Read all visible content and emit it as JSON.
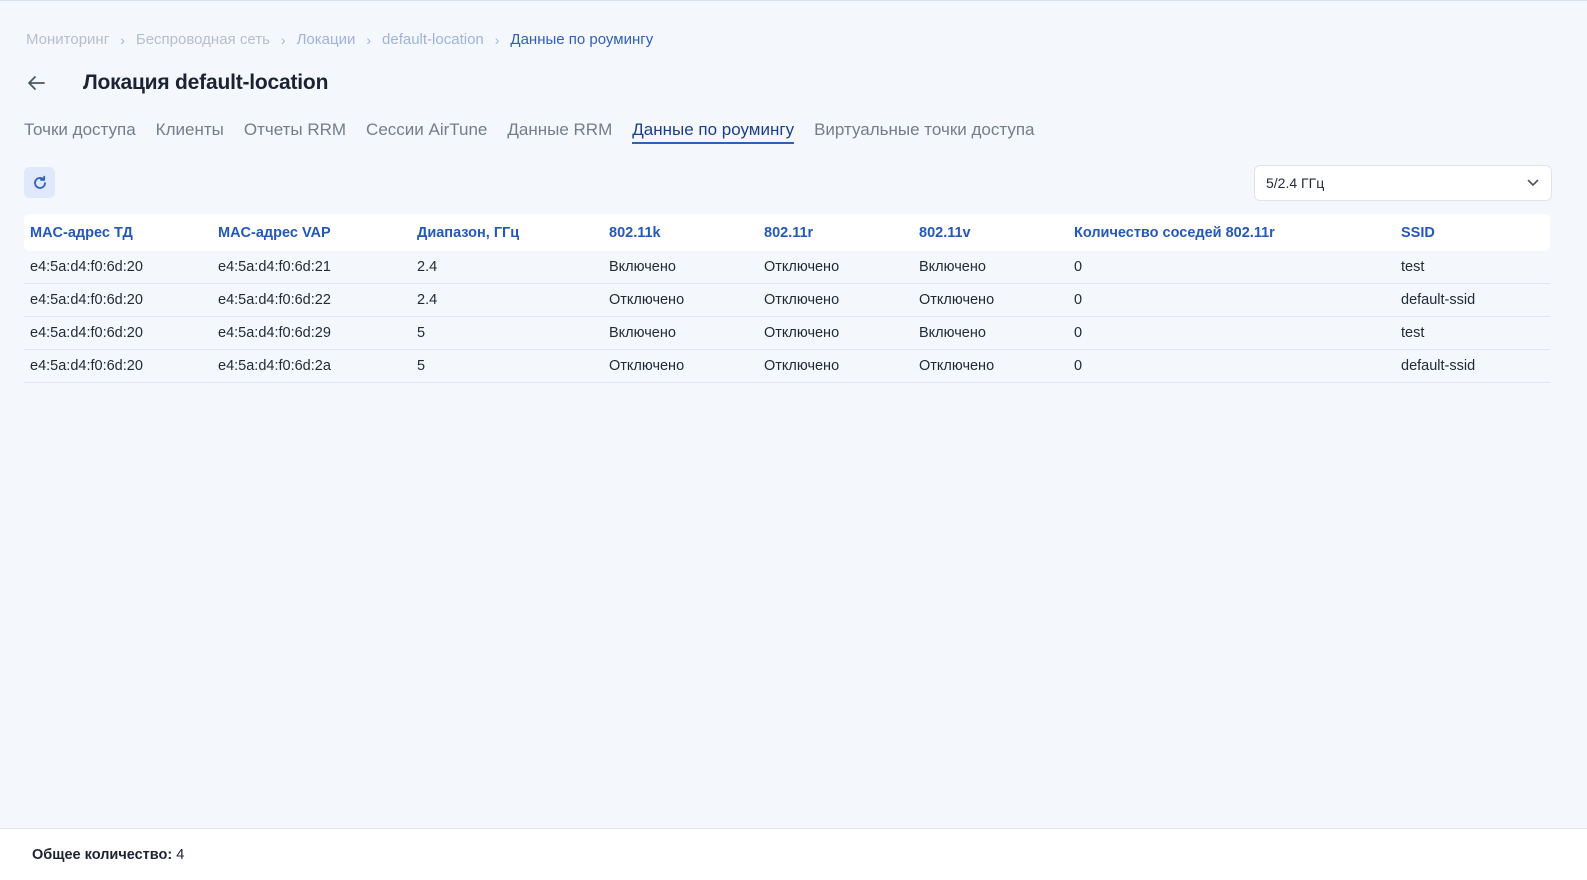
{
  "breadcrumb": {
    "items": [
      "Мониторинг",
      "Беспроводная сеть",
      "Локации",
      "default-location",
      "Данные по роумингу"
    ]
  },
  "header": {
    "title": "Локация default-location"
  },
  "tabs": [
    {
      "label": "Точки доступа"
    },
    {
      "label": "Клиенты"
    },
    {
      "label": "Отчеты RRM"
    },
    {
      "label": "Сессии AirTune"
    },
    {
      "label": "Данные RRM"
    },
    {
      "label": "Данные по роумингу",
      "active": true
    },
    {
      "label": "Виртуальные точки доступа"
    }
  ],
  "toolbar": {
    "band_select_value": "5/2.4 ГГц"
  },
  "table": {
    "columns": [
      "MAC-адрес ТД",
      "MAC-адрес VAP",
      "Диапазон, ГГц",
      "802.11k",
      "802.11r",
      "802.11v",
      "Количество соседей 802.11r",
      "SSID"
    ],
    "rows": [
      [
        "e4:5a:d4:f0:6d:20",
        "e4:5a:d4:f0:6d:21",
        "2.4",
        "Включено",
        "Отключено",
        "Включено",
        "0",
        "test"
      ],
      [
        "e4:5a:d4:f0:6d:20",
        "e4:5a:d4:f0:6d:22",
        "2.4",
        "Отключено",
        "Отключено",
        "Отключено",
        "0",
        "default-ssid"
      ],
      [
        "e4:5a:d4:f0:6d:20",
        "e4:5a:d4:f0:6d:29",
        "5",
        "Включено",
        "Отключено",
        "Включено",
        "0",
        "test"
      ],
      [
        "e4:5a:d4:f0:6d:20",
        "e4:5a:d4:f0:6d:2a",
        "5",
        "Отключено",
        "Отключено",
        "Отключено",
        "0",
        "default-ssid"
      ]
    ]
  },
  "footer": {
    "total_label": "Общее количество:",
    "total_value": "4"
  },
  "colors": {
    "accent": "#2f5fbd",
    "header_text": "#2458b8",
    "background": "#f4f7fc"
  },
  "icons": {
    "back": "arrow-left-icon",
    "refresh": "refresh-icon",
    "dropdown": "chevron-down-icon",
    "breadcrumb_sep": "chevron-right-icon"
  }
}
